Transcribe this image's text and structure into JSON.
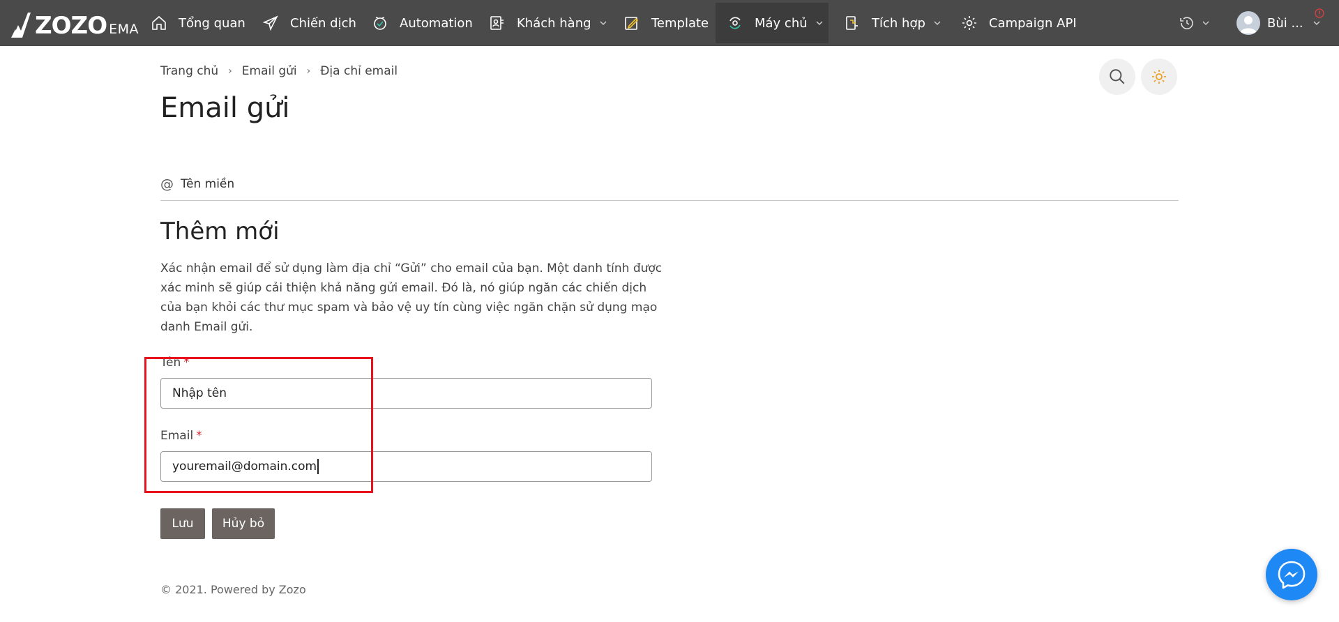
{
  "brand": {
    "logo_text": "ZOZO",
    "logo_sub": "EMA"
  },
  "nav": {
    "items": [
      {
        "label": "Tổng quan",
        "icon": "home-icon"
      },
      {
        "label": "Chiến dịch",
        "icon": "send-icon"
      },
      {
        "label": "Automation",
        "icon": "shield-check-icon"
      },
      {
        "label": "Khách hàng",
        "icon": "contacts-icon"
      },
      {
        "label": "Template",
        "icon": "edit-icon"
      },
      {
        "label": "Máy chủ",
        "icon": "server-sync-icon"
      },
      {
        "label": "Tích hợp",
        "icon": "integration-icon"
      },
      {
        "label": "Campaign API",
        "icon": "gear-icon"
      }
    ],
    "user_name": "Bùi ..."
  },
  "breadcrumb": [
    "Trang chủ",
    "Email gửi",
    "Địa chỉ email"
  ],
  "page_title": "Email gửi",
  "tabs": {
    "domain_label": "Tên miền"
  },
  "form": {
    "title": "Thêm mới",
    "description": "Xác nhận email để sử dụng làm địa chỉ “Gửi” cho email của bạn. Một danh tính được xác minh sẽ giúp cải thiện khả năng gửi email. Đó là, nó giúp ngăn các chiến dịch của bạn khỏi các thư mục spam và bảo vệ uy tín cùng việc ngăn chặn sử dụng mạo danh Email gửi.",
    "name_label": "Tên",
    "name_placeholder": "Nhập tên",
    "email_label": "Email",
    "email_value": "youremail@domain.com",
    "required_mark": "*",
    "save_label": "Lưu",
    "cancel_label": "Hủy bỏ"
  },
  "footer": {
    "text": "© 2021. Powered by Zozo"
  },
  "colors": {
    "topbar": "#4a4a4a",
    "button": "#6b6460",
    "required": "#d3212a",
    "highlight": "#e8121c",
    "messenger": "#1e88f5"
  }
}
